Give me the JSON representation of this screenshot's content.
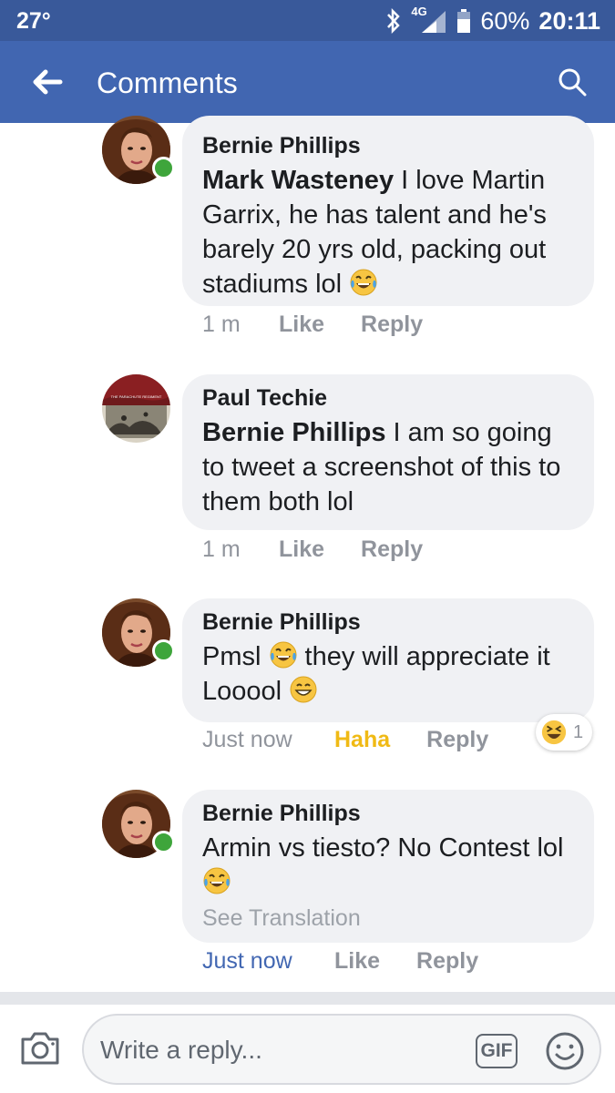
{
  "status_bar": {
    "temperature": "27°",
    "network": "4G",
    "battery": "60%",
    "time": "20:11"
  },
  "app_bar": {
    "title": "Comments",
    "back_icon": "back-arrow-icon",
    "search_icon": "search-icon"
  },
  "comments": [
    {
      "author": "Bernie Phillips",
      "mention": "Mark Wasteney",
      "text": " I love Martin Garrix, he has talent and he's barely 20 yrs old, packing out stadiums lol ",
      "emoji": "tears-of-joy-emoji",
      "time": "1 m",
      "like": "Like",
      "reply": "Reply",
      "online": true
    },
    {
      "author": "Paul Techie",
      "mention": "Bernie Phillips",
      "text": " I am so going to tweet a screenshot of this to them both lol",
      "time": "1 m",
      "like": "Like",
      "reply": "Reply",
      "online": false,
      "avatar_text": "THE PARACHUTE REGIMENT"
    },
    {
      "author": "Bernie Phillips",
      "text_before": "Pmsl ",
      "text_middle": " they will appreciate it Looool ",
      "emojis": [
        "tears-of-joy-emoji",
        "grinning-emoji"
      ],
      "time": "Just now",
      "like": "Haha",
      "reply": "Reply",
      "reaction_count": "1",
      "online": true
    },
    {
      "author": "Bernie Phillips",
      "text": "Armin vs tiesto? No Contest lol ",
      "emoji": "tears-of-joy-emoji",
      "translation": "See Translation",
      "time": "Just now",
      "like": "Like",
      "reply": "Reply",
      "online": true
    }
  ],
  "composer": {
    "placeholder": "Write a reply...",
    "gif_label": "GIF",
    "camera_icon": "camera-icon",
    "emoji_icon": "smiley-icon"
  },
  "colors": {
    "status_bar": "#39599a",
    "app_bar": "#4166b1",
    "bubble": "#f0f1f4",
    "haha": "#f0ba15",
    "online": "#3ea53b",
    "link_blue": "#4267b2"
  }
}
